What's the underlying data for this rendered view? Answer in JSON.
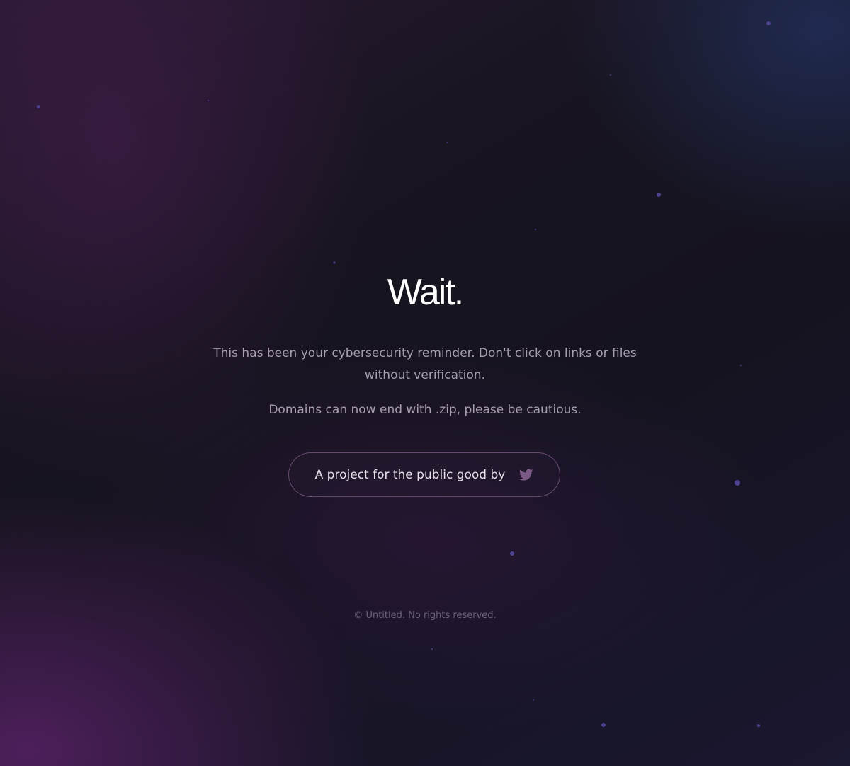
{
  "hero": {
    "title": "Wait.",
    "reminder": "This has been your cybersecurity reminder. Don't click on links or files without verification.",
    "zip_note": "Domains can now end with .zip, please be cautious."
  },
  "credit": {
    "label": "A project for the public good by",
    "icon": "twitter-icon",
    "icon_color": "#7b5a86"
  },
  "footer": {
    "text": "© Untitled. No rights reserved."
  },
  "colors": {
    "title": "#ffffff",
    "body_text": "#a79fb0",
    "footer_text": "#6e6479",
    "star": "#4a3f8a"
  }
}
